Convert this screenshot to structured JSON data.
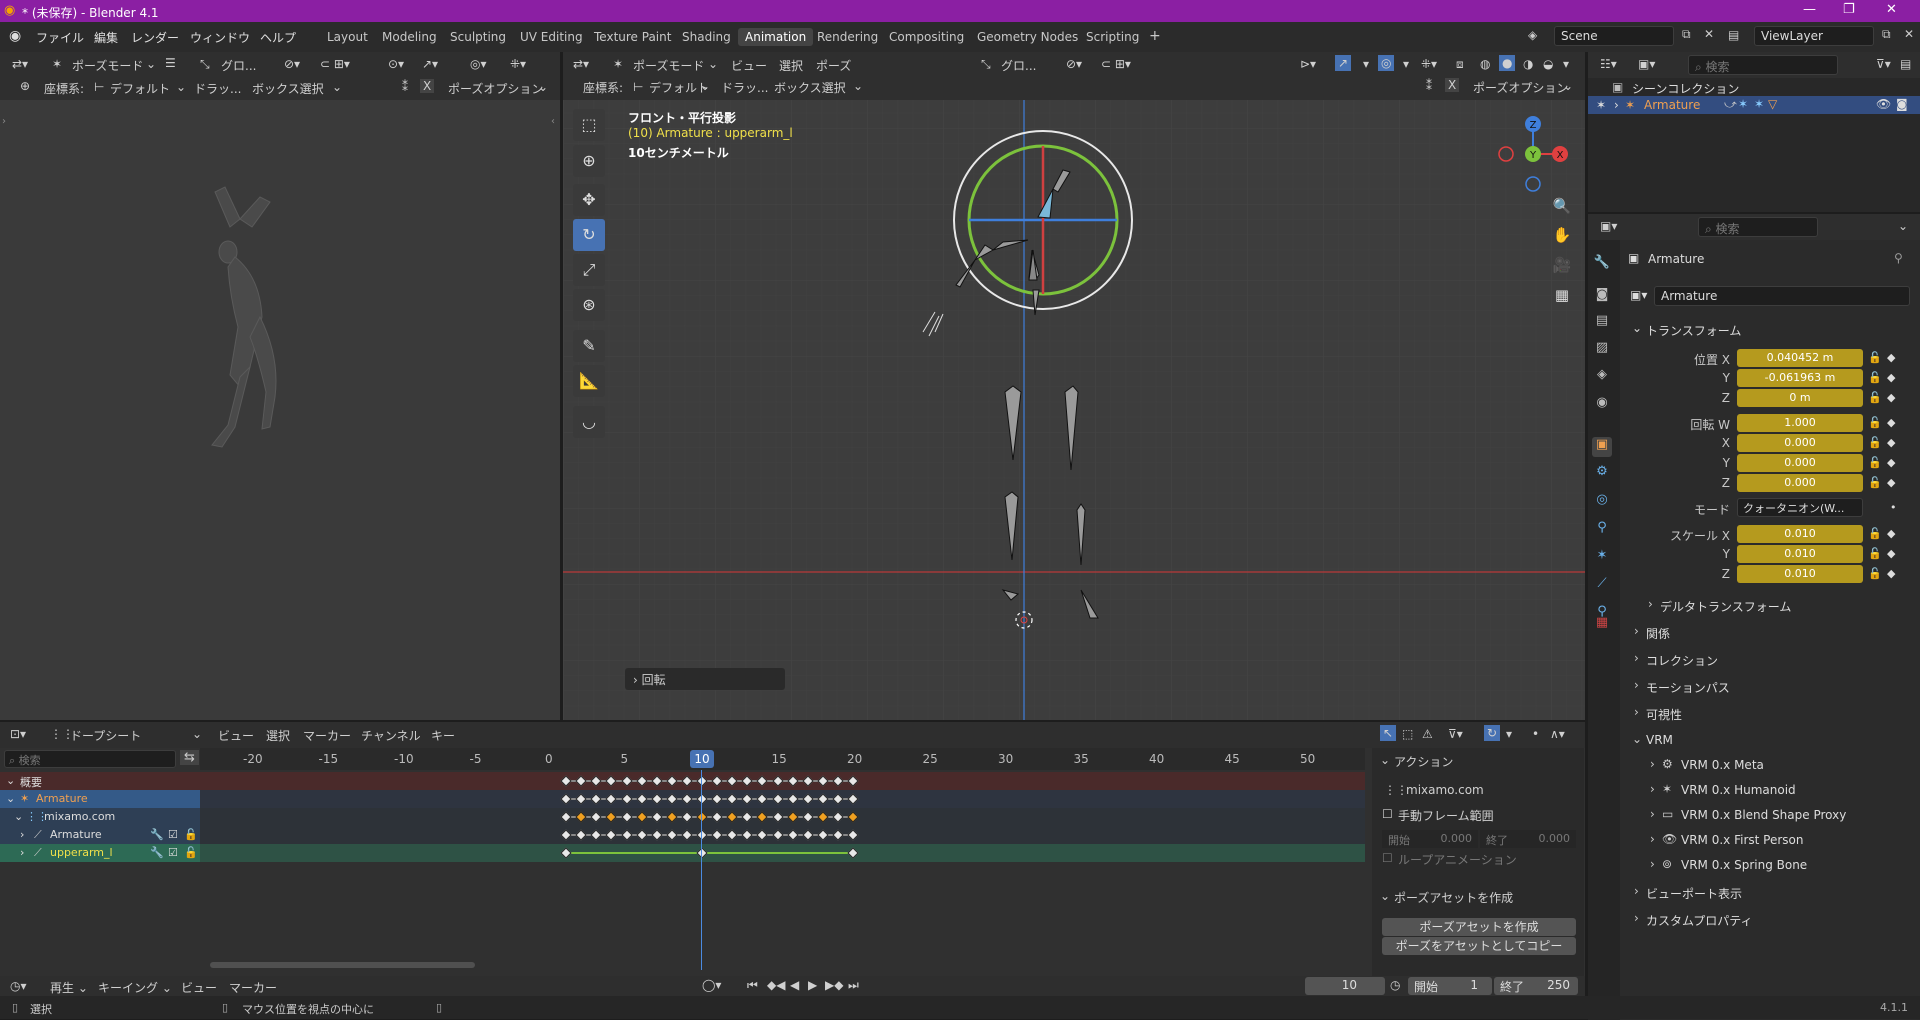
{
  "title": "* (未保存) - Blender 4.1",
  "menus": [
    "ファイル",
    "編集",
    "レンダー",
    "ウィンドウ",
    "ヘルプ"
  ],
  "workspaces": [
    "Layout",
    "Modeling",
    "Sculpting",
    "UV Editing",
    "Texture Paint",
    "Shading",
    "Animation",
    "Rendering",
    "Compositing",
    "Geometry Nodes",
    "Scripting"
  ],
  "active_workspace": "Animation",
  "scene": "Scene",
  "view_layer": "ViewLayer",
  "left_viewport": {
    "mode": "ポーズモード",
    "orient": "グロ...",
    "coord_label": "座標系:",
    "coord": "デフォルト",
    "drag": "ドラッ...",
    "select": "ボックス選択",
    "options": "ポーズオプション"
  },
  "main_viewport": {
    "mode": "ポーズモード",
    "menu_view": "ビュー",
    "menu_select": "選択",
    "menu_pose": "ポーズ",
    "orient": "グロ...",
    "coord_label": "座標系:",
    "coord": "デフォルト",
    "drag": "ドラッ...",
    "select": "ボックス選択",
    "options": "ポーズオプション",
    "overlay_title": "フロント・平行投影",
    "overlay_obj": "(10) Armature : upperarm_l",
    "overlay_scale": "10センチメートル",
    "op_panel": "回転"
  },
  "gizmo": {
    "z": "Z",
    "y": "Y",
    "x": "X",
    "color_x": "#e04040",
    "color_y": "#7cc23c",
    "color_z": "#3f7fdc"
  },
  "outliner": {
    "search": "検索",
    "collection": "シーンコレクション",
    "armature": "Armature"
  },
  "props": {
    "search": "検索",
    "object_name": "Armature",
    "object_field": "Armature",
    "transform": "トランスフォーム",
    "pos_label": "位置 X",
    "pos": [
      "0.040452 m",
      "-0.061963 m",
      "0 m"
    ],
    "rot_label": "回転 W",
    "rot": [
      "1.000",
      "0.000",
      "0.000",
      "0.000"
    ],
    "mode_label": "モード",
    "mode": "クォータニオン(W...",
    "scale_label": "スケール X",
    "scale": [
      "0.010",
      "0.010",
      "0.010"
    ],
    "y": "Y",
    "z": "Z",
    "x": "X",
    "delta": "デルタトランスフォーム",
    "sections": [
      "関係",
      "コレクション",
      "モーションパス",
      "可視性"
    ],
    "vrm": "VRM",
    "vrm_items": [
      "VRM 0.x Meta",
      "VRM 0.x Humanoid",
      "VRM 0.x Blend Shape Proxy",
      "VRM 0.x First Person",
      "VRM 0.x Spring Bone"
    ],
    "sections2": [
      "ビューポート表示",
      "カスタムプロパティ"
    ]
  },
  "dopesheet": {
    "mode": "ドープシート",
    "menus": [
      "ビュー",
      "選択",
      "マーカー",
      "チャンネル",
      "キー"
    ],
    "search": "検索",
    "ruler": [
      "-20",
      "-15",
      "-10",
      "-5",
      "0",
      "5",
      "10",
      "15",
      "20",
      "25",
      "30",
      "35",
      "40",
      "45",
      "50"
    ],
    "current_frame": "10",
    "channels": [
      "概要",
      "Armature",
      "mixamo.com",
      "Armature",
      "upperarm_l"
    ],
    "action_panel": "アクション",
    "action_name": "mixamo.com",
    "manual_range": "手動フレーム範囲",
    "start_lbl": "開始",
    "start_val": "0.000",
    "end_lbl": "終了",
    "end_val": "0.000",
    "loop": "ループアニメーション",
    "pose_asset": "ポーズアセットを作成",
    "pose_asset_btn": "ポーズアセットを作成",
    "pose_copy_btn": "ポーズをアセットとしてコピー"
  },
  "timeline": {
    "menus": [
      "再生",
      "キーイング",
      "ビュー",
      "マーカー"
    ],
    "frame": "10",
    "start_lbl": "開始",
    "start": "1",
    "end_lbl": "終了",
    "end": "250"
  },
  "status": {
    "select": "選択",
    "hint": "マウス位置を視点の中心に",
    "version": "4.1.1"
  }
}
